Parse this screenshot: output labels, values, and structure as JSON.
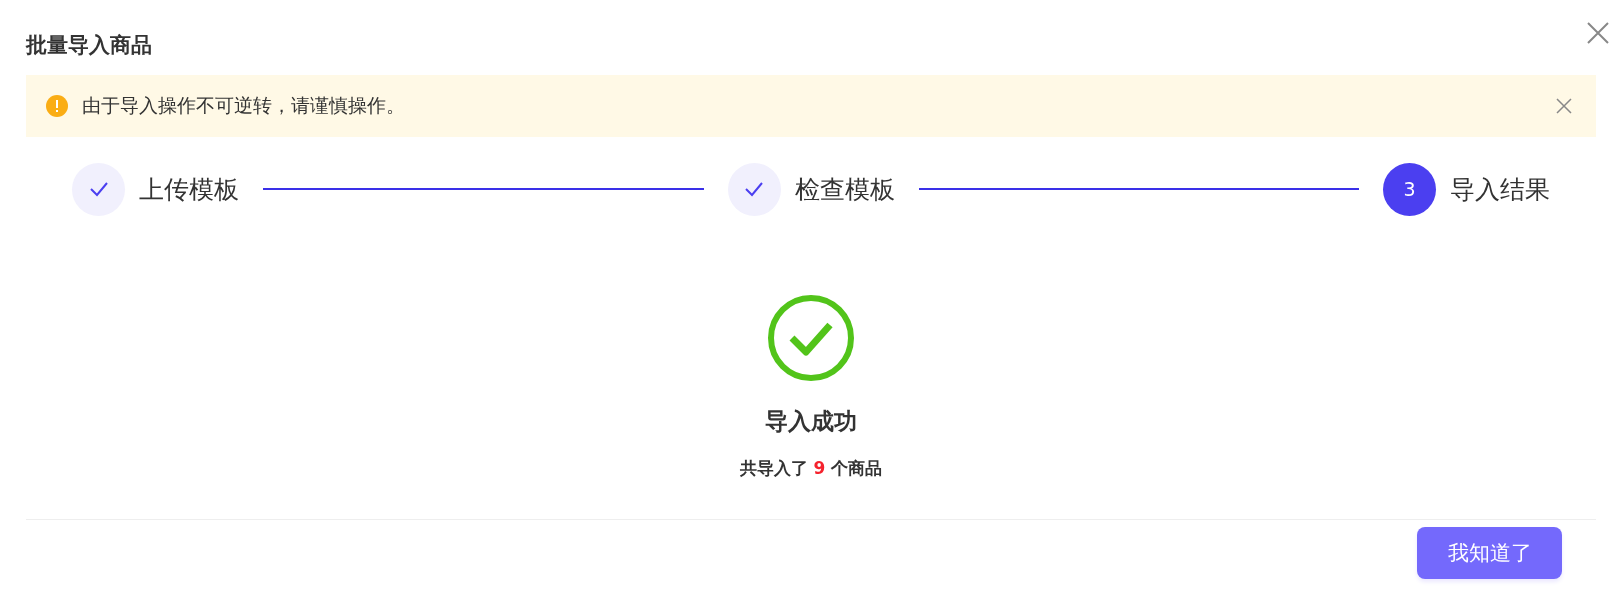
{
  "dialog": {
    "title": "批量导入商品"
  },
  "alert": {
    "text": "由于导入操作不可逆转，请谨慎操作。"
  },
  "steps": [
    {
      "label": "上传模板",
      "done": true
    },
    {
      "label": "检查模板",
      "done": true
    },
    {
      "label": "导入结果",
      "done": false,
      "number": "3"
    }
  ],
  "result": {
    "title": "导入成功",
    "summary_prefix": "共导入了",
    "count": "9",
    "summary_suffix": "个商品"
  },
  "buttons": [
    {
      "label": "我知道了"
    }
  ]
}
